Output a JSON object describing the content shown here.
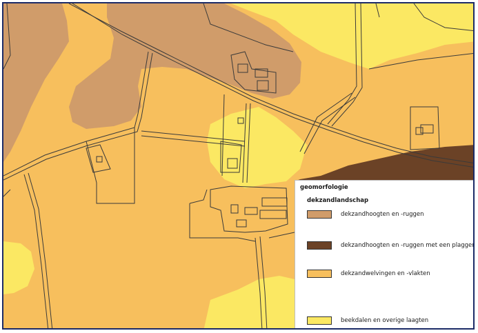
{
  "legend": {
    "title": "geomorfologie",
    "subtitle": "dekzandlandschap",
    "items": [
      {
        "label": "dekzandhoogten en -ruggen",
        "color": "#d09c6a"
      },
      {
        "label": "dekzandhoogten en -ruggen met een plaggendek",
        "color": "#6b4226"
      },
      {
        "label": "dekzandwelvingen en -vlakten",
        "color": "#f7bf5d"
      },
      {
        "label": "beekdalen en overige laagten",
        "color": "#fbe863"
      }
    ]
  },
  "colors": {
    "frame": "#1b2a66",
    "line": "#3a3a3a"
  }
}
